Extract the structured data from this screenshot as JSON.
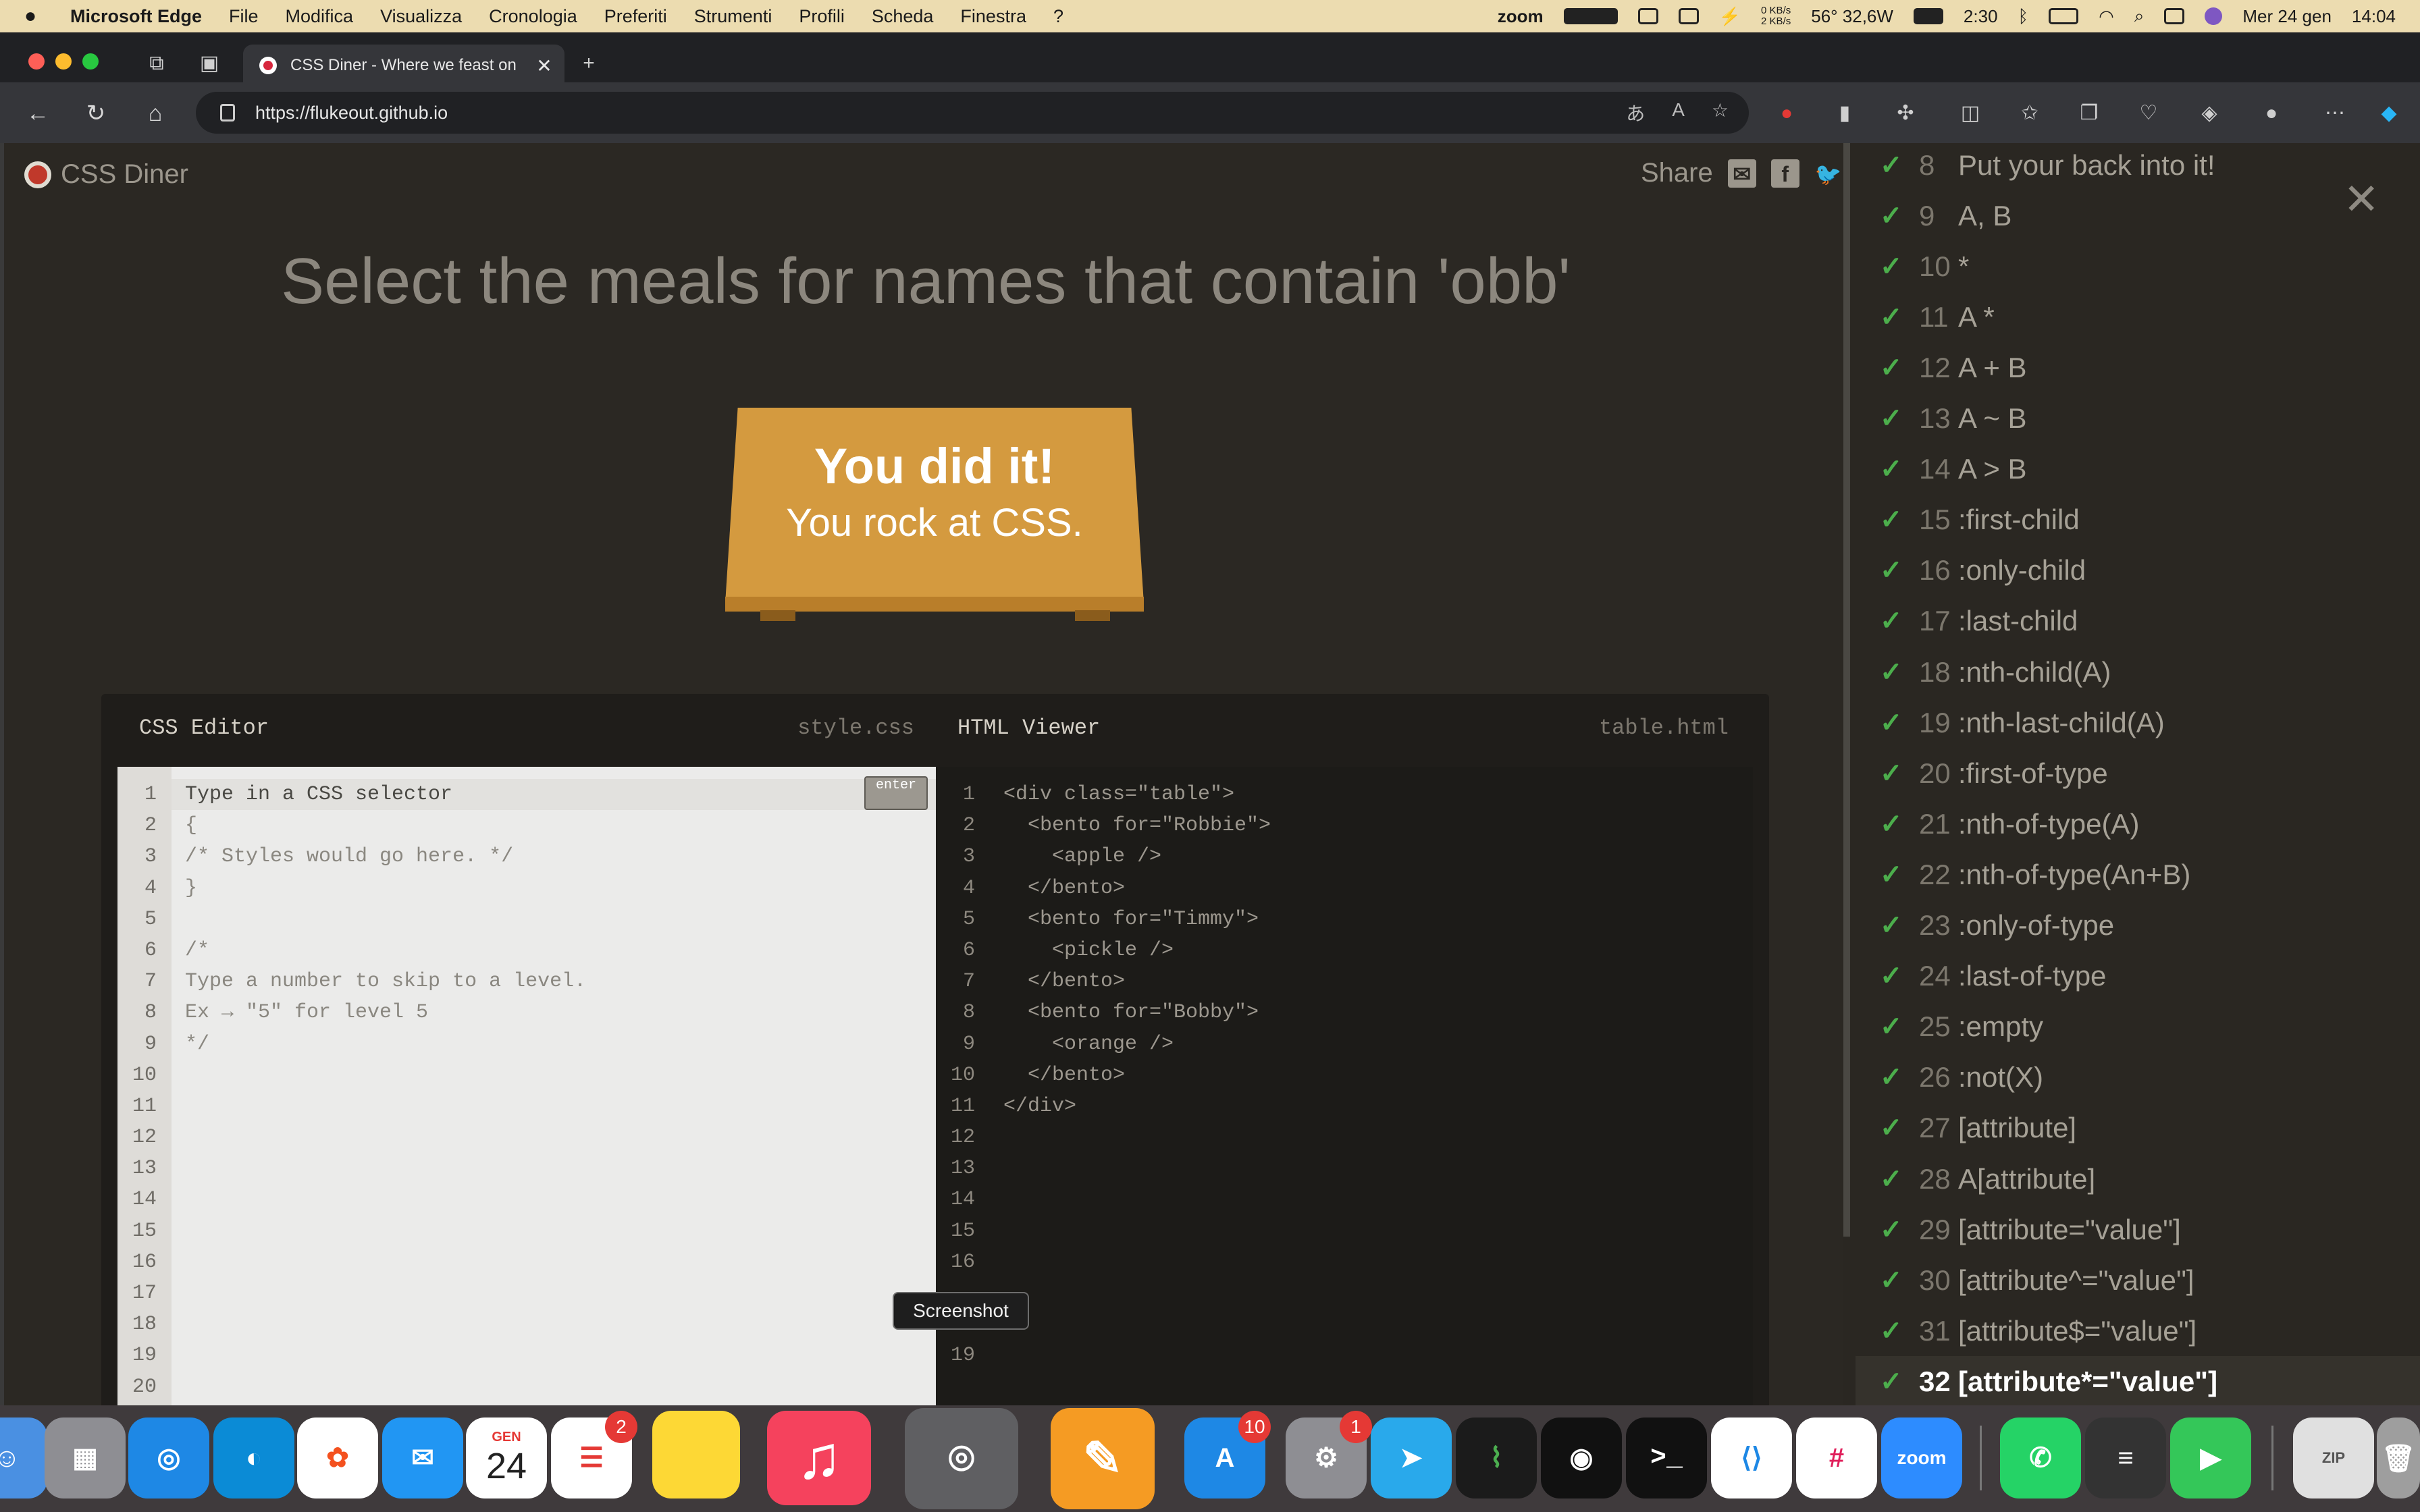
{
  "menubar": {
    "app": "Microsoft Edge",
    "items": [
      "File",
      "Modifica",
      "Visualizza",
      "Cronologia",
      "Preferiti",
      "Strumenti",
      "Profili",
      "Scheda",
      "Finestra",
      "?"
    ],
    "zoom": "zoom",
    "net_up": "0 KB/s",
    "net_down": "2 KB/s",
    "temp_power": "56° 32,6W",
    "battery_time": "2:30",
    "date": "Mer 24 gen",
    "time": "14:04"
  },
  "browser": {
    "tab_title": "CSS Diner - Where we feast on",
    "url": "https://flukeout.github.io"
  },
  "game": {
    "logo": "CSS Diner",
    "share": "Share",
    "order": "Select the meals for names that contain 'obb'",
    "win_big": "You did it!",
    "win_small": "You rock at CSS."
  },
  "editor": {
    "css_label": "CSS Editor",
    "css_file": "style.css",
    "html_label": "HTML Viewer",
    "html_file": "table.html",
    "enter": "enter",
    "css_lines": [
      "Type in a CSS selector",
      "{",
      "/* Styles would go here. */",
      "}",
      "",
      "/*",
      "Type a number to skip to a level.",
      "Ex → \"5\" for level 5",
      "*/"
    ],
    "html_lines": [
      "<div class=\"table\">",
      "  <bento for=\"Robbie\">",
      "    <apple />",
      "  </bento>",
      "  <bento for=\"Timmy\">",
      "    <pickle />",
      "  </bento>",
      "  <bento for=\"Bobby\">",
      "    <orange />",
      "  </bento>",
      "</div>"
    ],
    "css_line_numbers": [
      "1",
      "2",
      "3",
      "4",
      "5",
      "6",
      "7",
      "8",
      "9",
      "10",
      "11",
      "12",
      "13",
      "14",
      "15",
      "16",
      "17",
      "18",
      "19",
      "20"
    ],
    "html_line_numbers": [
      "1",
      "2",
      "3",
      "4",
      "5",
      "6",
      "7",
      "8",
      "9",
      "10",
      "11",
      "12",
      "13",
      "14",
      "15",
      "16",
      "",
      "",
      "19"
    ]
  },
  "levels": [
    {
      "num": "8",
      "label": "Put your back into it!"
    },
    {
      "num": "9",
      "label": "A, B"
    },
    {
      "num": "10",
      "label": "*"
    },
    {
      "num": "11",
      "label": "A *"
    },
    {
      "num": "12",
      "label": "A + B"
    },
    {
      "num": "13",
      "label": "A ~ B"
    },
    {
      "num": "14",
      "label": "A > B"
    },
    {
      "num": "15",
      "label": ":first-child"
    },
    {
      "num": "16",
      "label": ":only-child"
    },
    {
      "num": "17",
      "label": ":last-child"
    },
    {
      "num": "18",
      "label": ":nth-child(A)"
    },
    {
      "num": "19",
      "label": ":nth-last-child(A)"
    },
    {
      "num": "20",
      "label": ":first-of-type"
    },
    {
      "num": "21",
      "label": ":nth-of-type(A)"
    },
    {
      "num": "22",
      "label": ":nth-of-type(An+B)"
    },
    {
      "num": "23",
      "label": ":only-of-type"
    },
    {
      "num": "24",
      "label": ":last-of-type"
    },
    {
      "num": "25",
      "label": ":empty"
    },
    {
      "num": "26",
      "label": ":not(X)"
    },
    {
      "num": "27",
      "label": "[attribute]"
    },
    {
      "num": "28",
      "label": "A[attribute]"
    },
    {
      "num": "29",
      "label": "[attribute=\"value\"]"
    },
    {
      "num": "30",
      "label": "[attribute^=\"value\"]"
    },
    {
      "num": "31",
      "label": "[attribute$=\"value\"]"
    },
    {
      "num": "32",
      "label": "[attribute*=\"value\"]"
    }
  ],
  "tooltip": "Screenshot",
  "dock": {
    "calendar_month": "GEN",
    "calendar_day": "24",
    "reminders_badge": "2",
    "appstore_badge": "10",
    "settings_badge": "1",
    "zoom_label": "zoom"
  },
  "colors": {
    "accent_check": "#4cae4c",
    "table": "#d49a3f",
    "logo_red": "#c0392b"
  }
}
